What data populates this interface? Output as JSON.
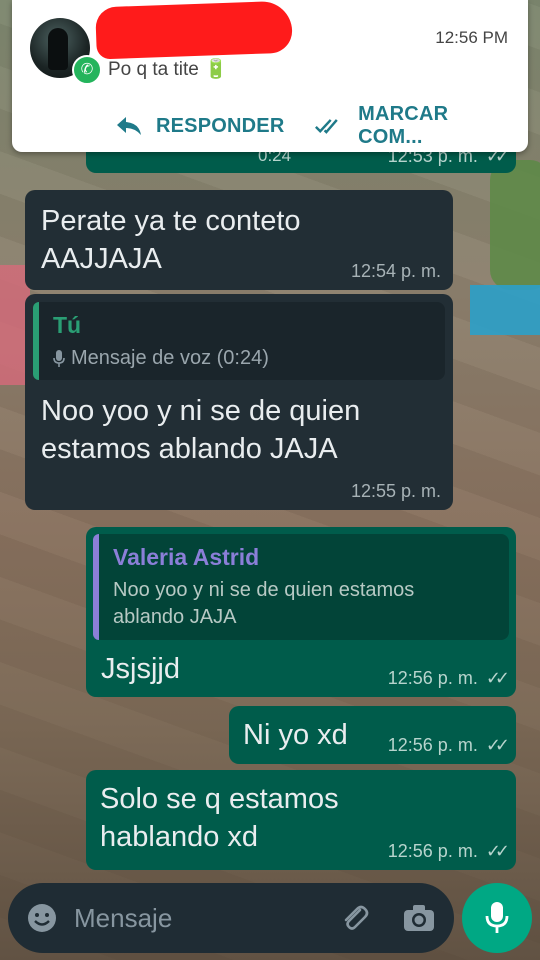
{
  "notification": {
    "time": "12:56 PM",
    "message": "Po q ta tite 🔋",
    "actions": {
      "reply": "RESPONDER",
      "mark_read": "MARCAR COM..."
    }
  },
  "partial_message": {
    "duration": "0:24",
    "time": "12:53 p. m."
  },
  "messages": [
    {
      "direction": "in",
      "text_line1": "Perate ya te conteto",
      "text_line2": "AAJJAJA",
      "time": "12:54 p. m."
    },
    {
      "direction": "in",
      "quote_author": "Tú",
      "quote_text": "Mensaje de voz (0:24)",
      "text_line1": "Noo yoo y ni se de quien",
      "text_line2": "estamos ablando JAJA",
      "time": "12:55 p. m."
    },
    {
      "direction": "out",
      "quote_author": "Valeria Astrid",
      "quote_line1": "Noo yoo y ni se de quien estamos",
      "quote_line2": "ablando JAJA",
      "text": "Jsjsjjd",
      "time": "12:56 p. m."
    },
    {
      "direction": "out",
      "text": "Ni yo xd",
      "time": "12:56 p. m."
    },
    {
      "direction": "out",
      "text_line1": "Solo se q estamos",
      "text_line2": "hablando xd",
      "time": "12:56 p. m."
    }
  ],
  "input": {
    "placeholder": "Mensaje"
  },
  "colors": {
    "incoming": "#222e35",
    "outgoing": "#005c4b",
    "accent": "#00a884",
    "quote_you": "#2a9e74",
    "quote_other": "#8b7fd8"
  },
  "icons": [
    "whatsapp-icon",
    "reply-icon",
    "double-check-icon",
    "mic-icon",
    "emoji-icon",
    "attach-icon",
    "camera-icon"
  ]
}
